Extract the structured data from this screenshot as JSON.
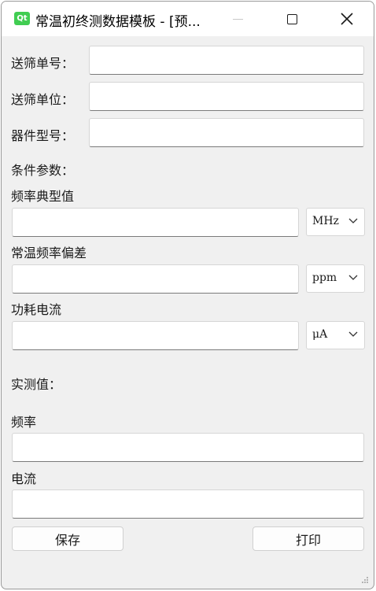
{
  "window": {
    "title": "常温初终测数据模板 - [预...",
    "icon_text": "Qt"
  },
  "form": {
    "batch_no_label": "送筛单号：",
    "batch_no_value": "",
    "unit_label": "送筛单位：",
    "unit_value": "",
    "model_label": "器件型号：",
    "model_value": "",
    "conditions_label": "条件参数：",
    "freq_typical_label": "频率典型值",
    "freq_typical_value": "",
    "freq_typical_unit": "MHz",
    "freq_dev_label": "常温频率偏差",
    "freq_dev_value": "",
    "freq_dev_unit": "ppm",
    "current_label": "功耗电流",
    "current_value": "",
    "current_unit": "μA",
    "measured_label": "实测值：",
    "measured_freq_label": "频率",
    "measured_freq_value": "",
    "measured_current_label": "电流",
    "measured_current_value": ""
  },
  "buttons": {
    "save": "保存",
    "print": "打印"
  },
  "icons": {
    "minimize": "minimize-icon",
    "maximize": "maximize-icon",
    "close": "close-icon",
    "dropdown": "chevron-down-icon",
    "resize": "resize-grip-icon"
  },
  "colors": {
    "app_icon": "#41cd52",
    "window_bg": "#f0f0f0",
    "titlebar_bg": "#ffffff"
  }
}
